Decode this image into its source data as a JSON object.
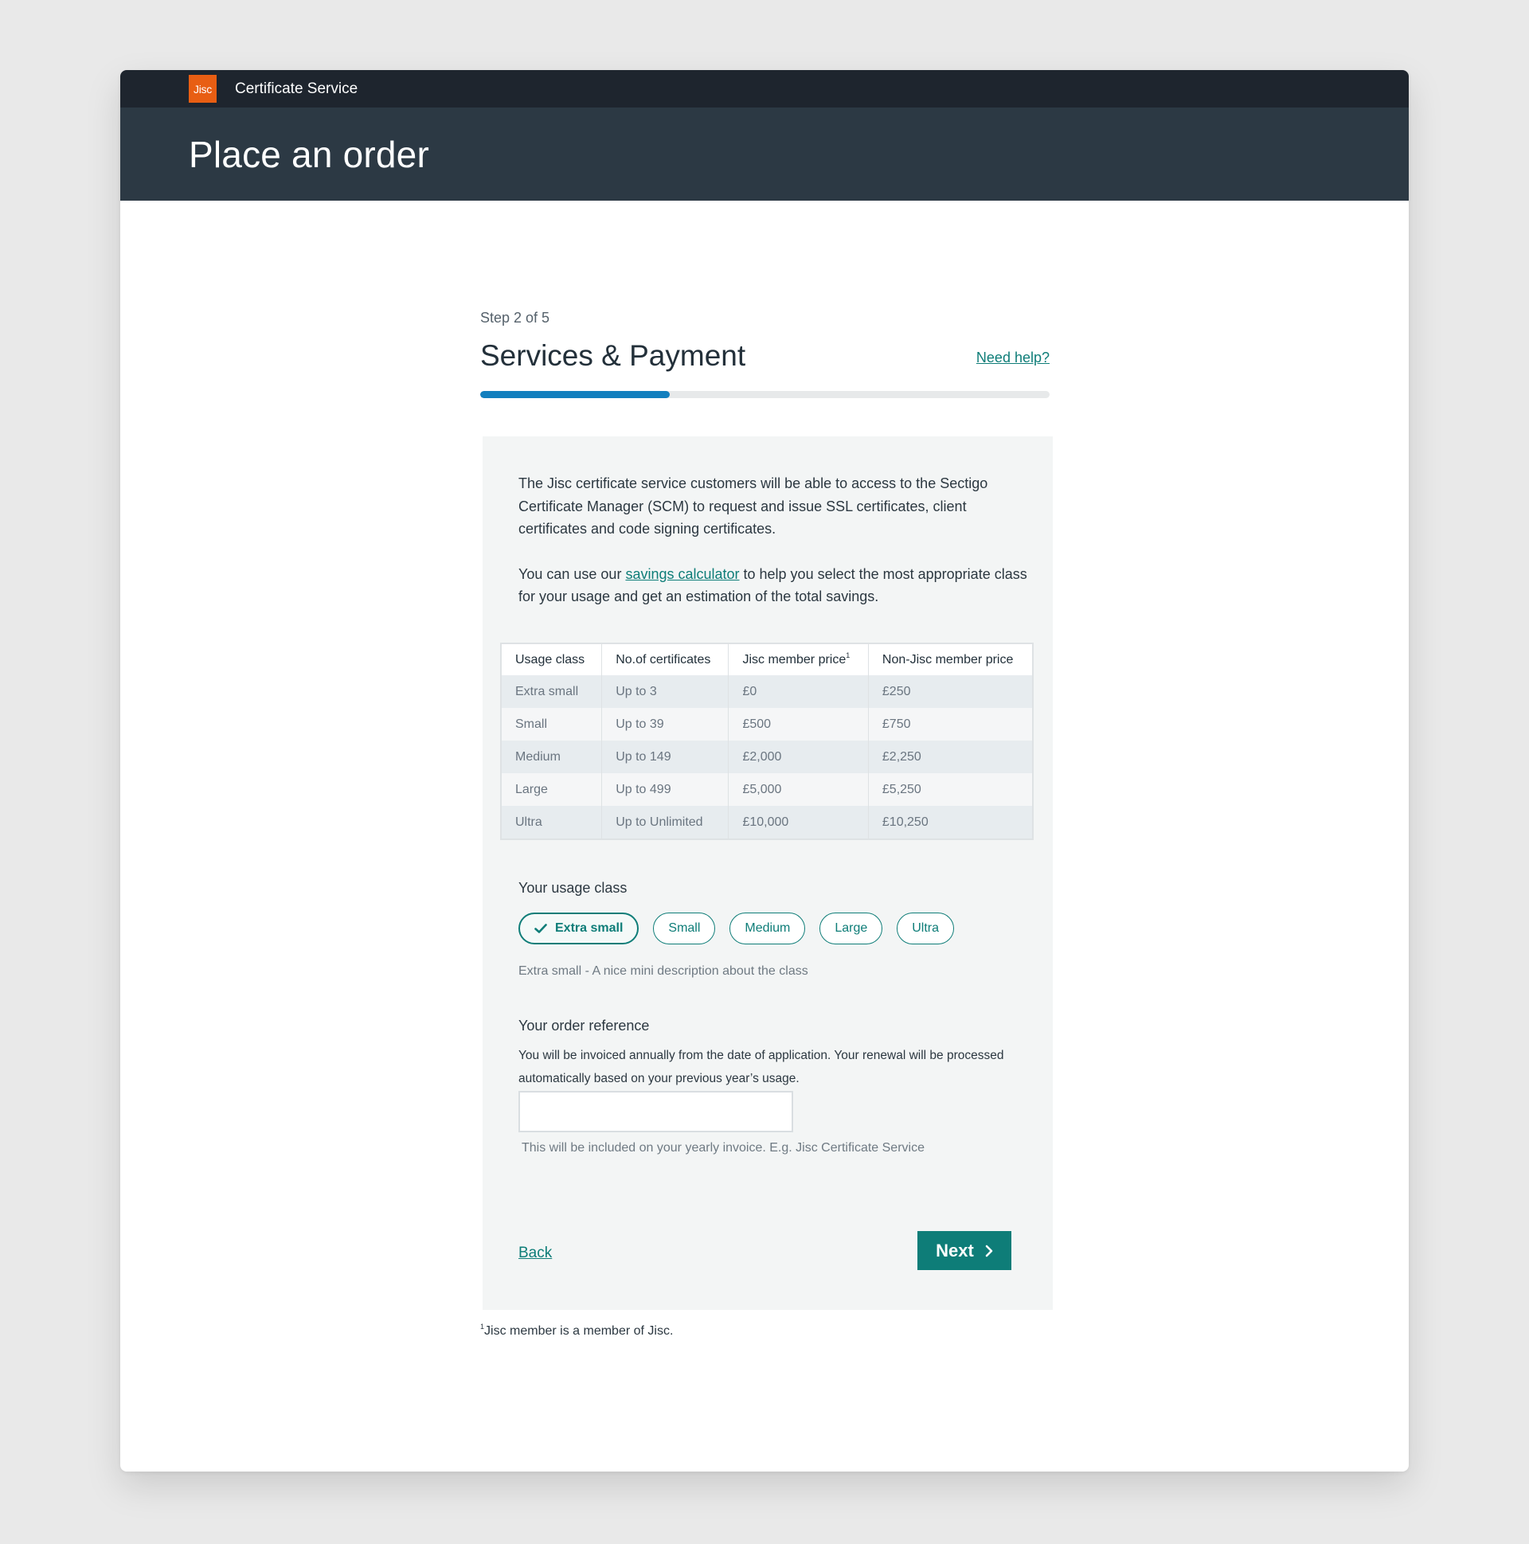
{
  "header": {
    "logo_text": "Jisc",
    "service_name": "Certificate Service",
    "page_title": "Place an order"
  },
  "step": {
    "label": "Step 2 of 5",
    "current": 2,
    "total": 5,
    "title": "Services & Payment",
    "help_link": "Need help?",
    "progress_percent": 33.3
  },
  "intro": {
    "paragraph1": "The Jisc certificate service customers will be able to access to the Sectigo Certificate Manager (SCM) to request and issue SSL certificates, client certificates and code signing certificates.",
    "paragraph2_prefix": "You can use our ",
    "paragraph2_link": "savings calculator",
    "paragraph2_suffix": " to help you select the most appropriate class for your usage and get an estimation of the total savings."
  },
  "table": {
    "headers": [
      "Usage class",
      "No.of certificates",
      "Jisc member price",
      "Non-Jisc member price"
    ],
    "footnote_marker": "1",
    "rows": [
      [
        "Extra small",
        "Up to 3",
        "£0",
        "£250"
      ],
      [
        "Small",
        "Up to 39",
        "£500",
        "£750"
      ],
      [
        "Medium",
        "Up to 149",
        "£2,000",
        "£2,250"
      ],
      [
        "Large",
        "Up to 499",
        "£5,000",
        "£5,250"
      ],
      [
        "Ultra",
        "Up to Unlimited",
        "£10,000",
        "£10,250"
      ]
    ]
  },
  "usage": {
    "label": "Your usage class",
    "options": [
      "Extra small",
      "Small",
      "Medium",
      "Large",
      "Ultra"
    ],
    "selected": "Extra small",
    "description": "Extra small - A nice mini description about the class"
  },
  "order_reference": {
    "label": "Your order reference",
    "help": "You will be invoiced annually from the date of application. Your renewal will be processed automatically based on your previous year’s usage.",
    "value": "",
    "placeholder": "",
    "hint": "This will be included on your yearly invoice. E.g. Jisc Certificate Service"
  },
  "actions": {
    "back_label": "Back",
    "next_label": "Next"
  },
  "footnote": {
    "marker": "1",
    "text": "Jisc member is a member of Jisc."
  },
  "colors": {
    "accent": "#0e7d78",
    "progress": "#127fbe",
    "logo": "#e85e13",
    "topbar": "#1e252e",
    "hero": "#2c3944"
  }
}
